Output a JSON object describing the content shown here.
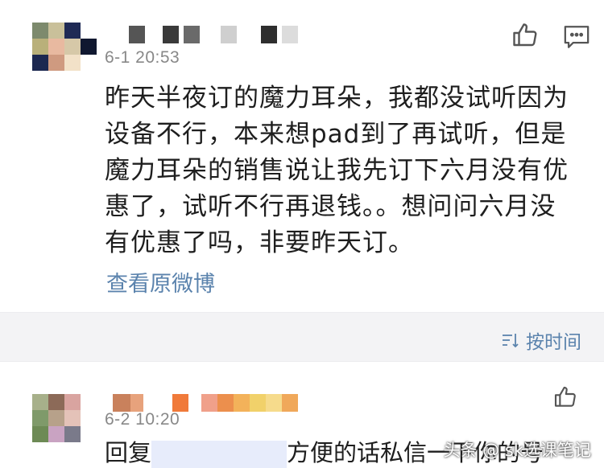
{
  "comments": [
    {
      "time": "6-1 20:53",
      "text": "昨天半夜订的魔力耳朵，我都没试听因为设备不行，本来想pad到了再试听，但是魔力耳朵的销售说让我先订下六月没有优惠了，试听不行再退钱。。想问问六月没有优惠了吗，非要昨天订。",
      "link": "查看原微博",
      "icons": [
        "thumbs-up-icon",
        "comment-icon"
      ]
    },
    {
      "time": "6-2 10:20",
      "reply_prefix": "回复",
      "reply_text": "方便的话私信一下你的号",
      "icons": [
        "thumbs-up-icon"
      ]
    }
  ],
  "toolbar": {
    "sort_label": "按时间",
    "sort_icon": "sort-icon"
  },
  "watermark": "头条 @ sk选课笔记",
  "colors": {
    "link": "#5b83ad",
    "toolbar_bg": "#f3f3f5",
    "time": "#888888"
  }
}
